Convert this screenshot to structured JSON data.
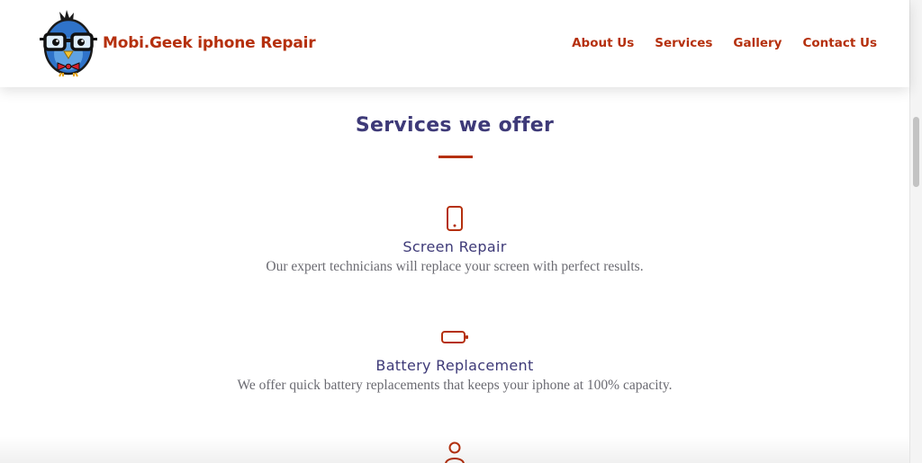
{
  "header": {
    "brand_name": "Mobi.Geek iphone Repair",
    "logo_icon": "nerd-bird-mascot-icon",
    "nav": [
      {
        "label": "About Us"
      },
      {
        "label": "Services"
      },
      {
        "label": "Gallery"
      },
      {
        "label": "Contact Us"
      }
    ]
  },
  "main": {
    "section_title": "Services we offer",
    "services": [
      {
        "icon": "phone-icon",
        "name": "Screen Repair",
        "description": "Our expert technicians will replace your screen with perfect results."
      },
      {
        "icon": "battery-icon",
        "name": "Battery Replacement",
        "description": "We offer quick battery replacements that keeps your iphone at 100% capacity."
      },
      {
        "icon": "person-icon",
        "name": "",
        "description": ""
      }
    ]
  },
  "colors": {
    "accent": "#b5300e",
    "heading": "#3e3a78",
    "body_text": "#6b6b72",
    "background": "#ffffff"
  }
}
